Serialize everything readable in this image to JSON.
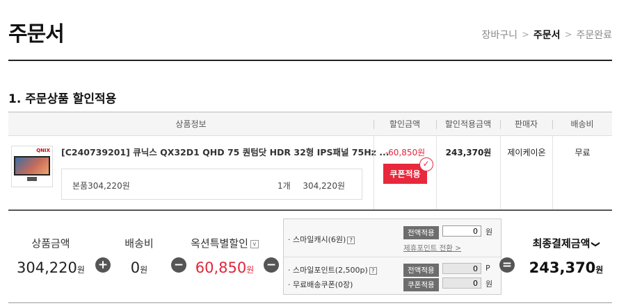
{
  "page": {
    "title": "주문서"
  },
  "breadcrumb": {
    "step1": "장바구니",
    "step2": "주문서",
    "step3": "주문완료",
    "sep": ">"
  },
  "section": {
    "title": "1. 주문상품 할인적용"
  },
  "table": {
    "headers": {
      "info": "상품정보",
      "discount": "할인금액",
      "applied": "할인적용금액",
      "seller": "판매자",
      "shipping": "배송비"
    },
    "row": {
      "brand": "QNIX",
      "name": "[C240739201] 큐닉스 QX32D1 QHD 75 퀀텀닷 HDR 32형 IPS패널 75Hz ...",
      "option_label": "본품304,220원",
      "qty": "1개",
      "option_price": "304,220원",
      "discount": "-60,850원",
      "coupon_button": "쿠폰적용",
      "coupon_check": "✓",
      "applied": "243,370원",
      "seller": "제이케이온",
      "shipping": "무료"
    }
  },
  "summary": {
    "product_label": "상품금액",
    "product_value": "304,220",
    "product_unit": "원",
    "plus": "+",
    "shipping_label": "배송비",
    "shipping_value": "0",
    "shipping_unit": "원",
    "minus": "−",
    "option_discount_label": "옥션특별할인",
    "option_discount_toggle": "v",
    "option_discount_value": "60,850",
    "option_discount_unit": "원",
    "equals": "=",
    "final_label": "최종결제금액",
    "final_chevron": "❯",
    "final_value": "243,370",
    "final_unit": "원"
  },
  "points": {
    "smile_cash_label": "· 스마일캐시(6원)",
    "q": "?",
    "smile_cash_btn": "전액적용",
    "smile_cash_value": "0",
    "won": "원",
    "partner_link": "제휴포인트 전환 >",
    "smile_point_label": "· 스마일포인트(2,500p)",
    "smile_point_btn": "전액적용",
    "smile_point_value": "0",
    "p": "P",
    "free_ship_label": "· 무료배송쿠폰(0장)",
    "free_ship_btn": "쿠폰적용",
    "free_ship_value": "0"
  }
}
